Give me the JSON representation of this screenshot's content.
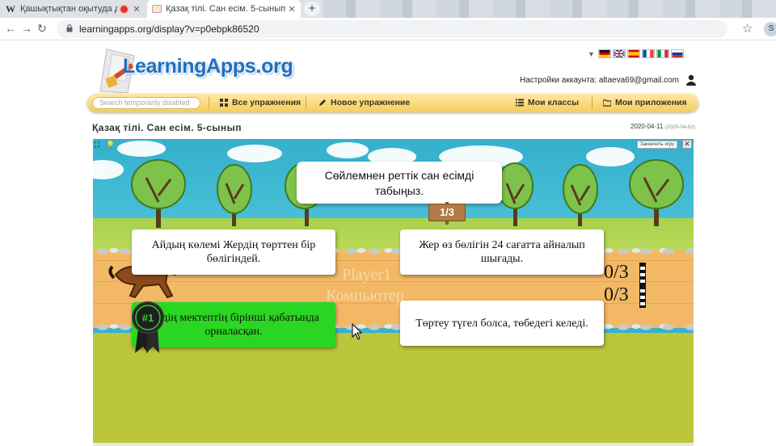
{
  "browser": {
    "tabs": [
      {
        "title": "Қашықтықтан оқытуда дағд",
        "favicon": "W",
        "recording": true,
        "active": false
      },
      {
        "title": "Қазақ тілі. Сан есім. 5-сынып",
        "active": true
      }
    ],
    "close_glyph": "✕",
    "new_tab_glyph": "+",
    "url": "learningapps.org/display?v=p0ebpk86520",
    "profile_initial": "S"
  },
  "site": {
    "logo": "LearningApps.org",
    "account_label": "Настройки аккаунта: altaeva69@gmail.com",
    "languages": [
      "de",
      "en",
      "es",
      "fr",
      "it",
      "ru"
    ],
    "search_placeholder": "Search temporarily disabled",
    "menu": {
      "all_exercises": "Все упражнения",
      "new_exercise": "Новое упражнение",
      "my_classes": "Мои классы",
      "my_apps": "Мои приложения"
    },
    "page_title": "Қазақ тілі. Сан есім. 5-сынып",
    "date": "2020-04-11",
    "date_small": "(2020-04-02)"
  },
  "game": {
    "close_button": "Закончить игру",
    "question": "Сөйлемнен реттік сан есімді табыңыз.",
    "progress": "1/3",
    "answers": [
      "Айдың көлемі Жердің төрттен бір бөлігіндей.",
      "Жер өз бөлігін 24 сағатта айналып шығады.",
      "Біздің мектептің бірінші қабатында орналасқан.",
      "Төртеу түгел болса, төбедегі келеді."
    ],
    "badge": "#1",
    "player_label": "Player1",
    "computer_label": "Компьютер",
    "player_score": "0/3",
    "computer_score": "0/3",
    "selected_answer_color": "#2bd622"
  }
}
